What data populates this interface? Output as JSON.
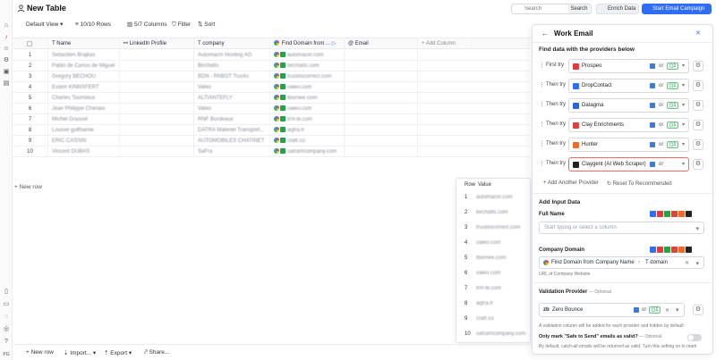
{
  "header": {
    "title": "New Table",
    "search_placeholder": "Search",
    "search_button": "Search",
    "enrich_button": "Enrich Data",
    "campaign_button": "Start Email Campaign"
  },
  "toolbar": {
    "view": "Default View",
    "rows": "10/10 Rows",
    "columns": "5/7 Columns",
    "filter": "Filter",
    "sort": "Sort"
  },
  "table": {
    "columns": [
      "Name",
      "LinkedIn Profile",
      "company",
      "Find Domain from ...",
      "Email",
      "+ Add Column"
    ],
    "rows": [
      {
        "num": "1",
        "name": "Sebastien Brajkas",
        "company": "Automacin Hosting AG",
        "domain": "automacin.com"
      },
      {
        "num": "2",
        "name": "Pablo de Carlos de Miguel",
        "company": "Birchatts",
        "domain": "birchatts.com"
      },
      {
        "num": "3",
        "name": "Gregory BECHOU",
        "company": "BDN - PABOT Trucks",
        "domain": "trucktocorrect.com"
      },
      {
        "num": "4",
        "name": "Evann KINNSFERT",
        "company": "Valeo",
        "domain": "valeo.com"
      },
      {
        "num": "5",
        "name": "Charles Tournieux",
        "company": "ALTIANTEFLY",
        "domain": "fbornee.com"
      },
      {
        "num": "6",
        "name": "Jean Philippe Chenais",
        "company": "Valeo",
        "domain": "valeo.com"
      },
      {
        "num": "7",
        "name": "Michel Grasset",
        "company": "RNF Bordeaux",
        "domain": "trnl-bi.com"
      },
      {
        "num": "8",
        "name": "Louiset guilhamie",
        "company": "DATRA Materiel Transport...",
        "domain": "aqfra.fr"
      },
      {
        "num": "9",
        "name": "ERIC CASSIN",
        "company": "AUTOMOBILES CHATINET",
        "domain": "craft.co"
      },
      {
        "num": "10",
        "name": "Vincent DUBAS",
        "company": "SaFra",
        "domain": "saframcompany.com"
      }
    ],
    "new_row": "+ New row"
  },
  "popup": {
    "header_row": "Row",
    "header_value": "Value",
    "items": [
      {
        "num": "1",
        "val": "automacin.com"
      },
      {
        "num": "2",
        "val": "birchatts.com"
      },
      {
        "num": "3",
        "val": "trucktocorrect.com"
      },
      {
        "num": "4",
        "val": "valeo.com"
      },
      {
        "num": "5",
        "val": "fbornee.com"
      },
      {
        "num": "6",
        "val": "valeo.com"
      },
      {
        "num": "7",
        "val": "trnl-bi.com"
      },
      {
        "num": "8",
        "val": "aqfra.fr"
      },
      {
        "num": "9",
        "val": "craft.co"
      },
      {
        "num": "10",
        "val": "saframcompany.com"
      }
    ]
  },
  "bottom": {
    "new_row": "New row",
    "import": "Import...",
    "export": "Export",
    "share": "Share..."
  },
  "panel": {
    "title": "Work Email",
    "providers_title": "Find data with the providers below",
    "providers": [
      {
        "try": "First try",
        "name": "Prospeo",
        "color": "#e23b3b",
        "credits": "1"
      },
      {
        "try": "Then try",
        "name": "DropContact",
        "color": "#2f6df6",
        "credits": "1"
      },
      {
        "try": "Then try",
        "name": "Datagma",
        "color": "#2a66d9",
        "credits": "1"
      },
      {
        "try": "Then try",
        "name": "Clay Enrichments",
        "color": "#d8453b",
        "credits": "1"
      },
      {
        "try": "Then try",
        "name": "Hunter",
        "color": "#f06b2a",
        "credits": "1"
      },
      {
        "try": "Then try",
        "name": "Claygent (AI Web Scraper)",
        "color": "#222222",
        "credits": ""
      }
    ],
    "or_text": "or",
    "add_provider": "+ Add Another Provider",
    "reset": "Reset To Recommended",
    "input_title": "Add Input Data",
    "full_name_label": "Full Name",
    "full_name_placeholder": "Start typing or select a column",
    "company_domain_label": "Company Domain",
    "company_domain_chip": "Find Domain from Company Name",
    "company_domain_sub": "domain",
    "company_domain_hint": "URL of Company Website",
    "validation_label": "Validation Provider",
    "validation_optional": "— Optional",
    "validation_provider": "Zero Bounce",
    "validation_credits": "1",
    "validation_note": "A validation column will be added for each provider and hidden by default",
    "safe_label": "Only mark \"Safe to Send\" emails as valid?",
    "safe_optional": "— Optional",
    "safe_note": "By default, catch-all emails will be returned as valid. Turn this setting on to mark"
  }
}
